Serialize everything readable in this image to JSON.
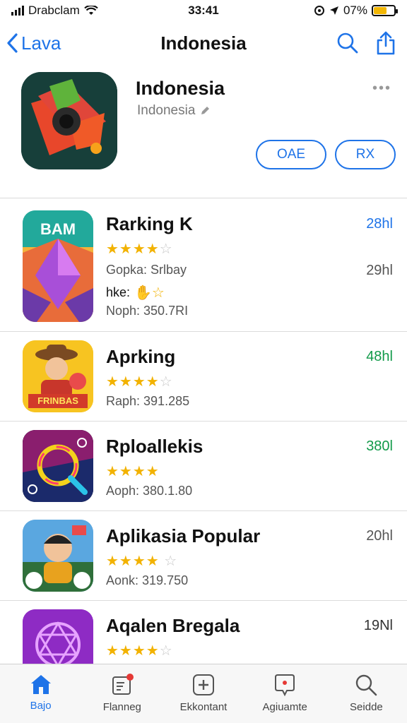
{
  "status_bar": {
    "carrier": "Drabclam",
    "time": "33:41",
    "battery_text": "07%",
    "battery_level": 0.65
  },
  "nav": {
    "back_label": "Lava",
    "title": "Indonesia",
    "search_icon": "search-icon",
    "share_icon": "share-icon"
  },
  "app": {
    "name": "Indonesia",
    "subtitle": "Indonesia",
    "more_label": "•••",
    "buttons": [
      "OAE",
      "RX"
    ]
  },
  "list": [
    {
      "title": "Rarking K",
      "rating": 4,
      "lines": [
        "Gopka: Srlbay",
        "Noph: 350.7RI"
      ],
      "extra_line": "hke:",
      "count": "28hl",
      "count_color": "#1e73e8",
      "secondary_count": "29hl",
      "icon_label": "BAM"
    },
    {
      "title": "Aprking",
      "rating": 4,
      "lines": [
        "Raph: 391.285"
      ],
      "count": "48hl",
      "count_color": "#129a4a",
      "icon_label": "FRINBAS"
    },
    {
      "title": "Rploallekis",
      "rating": 4,
      "lines": [
        "Aoph: 380.1.80"
      ],
      "count": "380l",
      "count_color": "#129a4a"
    },
    {
      "title": "Aplikasia Popular",
      "rating": 4,
      "lines": [
        "Aonk: 319.750"
      ],
      "count": "20hl",
      "count_color": "#555555"
    },
    {
      "title": "Aqalen Bregala",
      "rating": 4,
      "lines": [],
      "count": "19Nl",
      "count_color": "#333333"
    }
  ],
  "tabbar": {
    "tabs": [
      {
        "label": "Bajo",
        "icon": "home-icon"
      },
      {
        "label": "Flanneg",
        "icon": "edit-note-icon"
      },
      {
        "label": "Ekkontant",
        "icon": "add-square-icon"
      },
      {
        "label": "Agiuamte",
        "icon": "chat-bubble-icon"
      },
      {
        "label": "Seidde",
        "icon": "search-icon"
      }
    ]
  }
}
